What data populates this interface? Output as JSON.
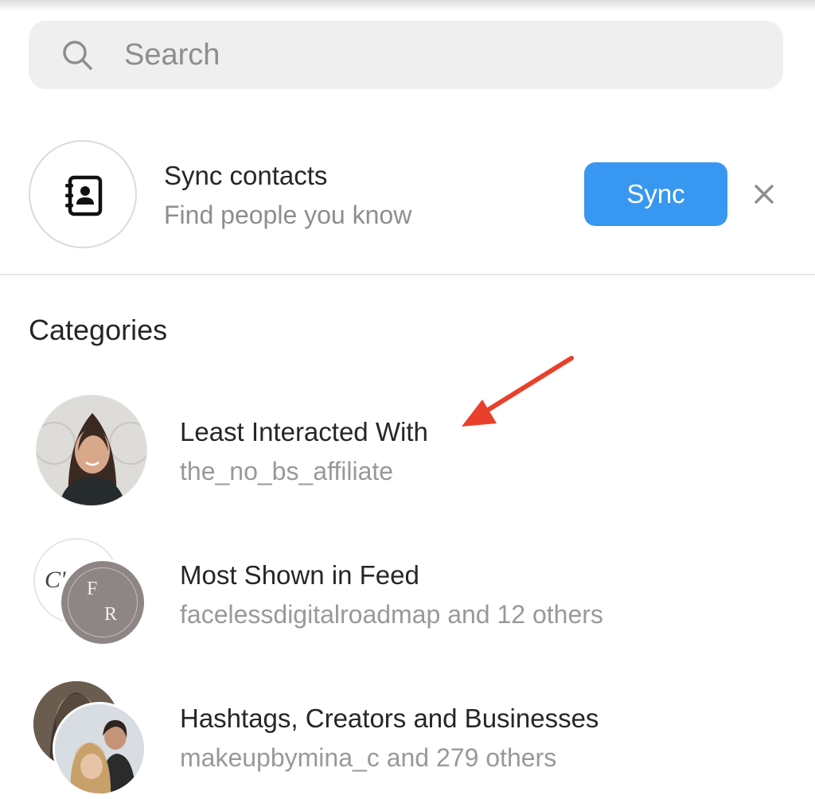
{
  "search": {
    "placeholder": "Search",
    "icon": "search-icon"
  },
  "sync_contacts": {
    "icon": "contacts-book-icon",
    "title": "Sync contacts",
    "subtitle": "Find people you know",
    "button_label": "Sync",
    "close_icon": "close-icon"
  },
  "categories": {
    "heading": "Categories",
    "items": [
      {
        "title": "Least Interacted With",
        "subtitle": "the_no_bs_affiliate"
      },
      {
        "title": "Most Shown in Feed",
        "subtitle": "facelessdigitalroadmap and 12 others",
        "avatar_monogram_top": "F",
        "avatar_monogram_bottom": "R",
        "avatar_back_letters": "C'"
      },
      {
        "title": "Hashtags, Creators and Businesses",
        "subtitle": "makeupbymina_c and 279 others"
      }
    ]
  },
  "annotation": {
    "arrow_color": "#e8402b"
  },
  "colors": {
    "accent": "#3897f0",
    "secondary_text": "#8e8e8e"
  }
}
